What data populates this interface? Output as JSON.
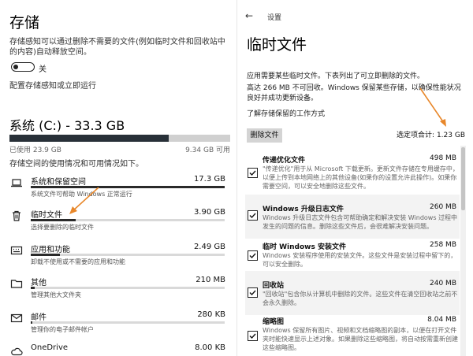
{
  "left": {
    "title": "存储",
    "sense_desc": "存储感知可以通过删除不需要的文件(例如临时文件和回收站中的内容)自动释放空间。",
    "toggle_label": "关",
    "config_link": "配置存储感知或立即运行",
    "drive_title": "系统 (C:) - 33.3 GB",
    "used": "已使用 23.9 GB",
    "available": "9.34 GB 可用",
    "drive_used_fraction": 0.72,
    "usage_desc": "存储空间的使用情况和可用情况如下。",
    "categories": [
      {
        "icon": "laptop-icon",
        "name": "系统和保留空间",
        "size": "17.3 GB",
        "sub": "系统文件可帮助 Windows 正常运行",
        "fraction": 1.0
      },
      {
        "icon": "trash-icon",
        "name": "临时文件",
        "size": "3.90 GB",
        "sub": "选择要删除的临时文件",
        "fraction": 0.23
      },
      {
        "icon": "keyboard-icon",
        "name": "应用和功能",
        "size": "2.49 GB",
        "sub": "卸载不使用或不需要的应用和功能",
        "fraction": 0.15
      },
      {
        "icon": "folder-icon",
        "name": "其他",
        "size": "210 MB",
        "sub": "管理其他大文件夹",
        "fraction": 0.02
      },
      {
        "icon": "mail-icon",
        "name": "邮件",
        "size": "280 KB",
        "sub": "管理你的电子邮件帐户",
        "fraction": 0.01
      },
      {
        "icon": "cloud-icon",
        "name": "OneDrive",
        "size": "8.00 KB",
        "sub": "",
        "fraction": 0.0
      }
    ]
  },
  "right": {
    "back_glyph": "←",
    "settings_label": "设置",
    "title": "临时文件",
    "desc1": "应用需要某些临时文件。下表列出了可立即删除的文件。",
    "desc2": "高达 266 MB 不可回收。Windows 保留某些存储，以确保性能状况良好并成功更新设备。",
    "link": "了解存储保留的工作方式",
    "delete_button": "删除文件",
    "total": "选定项合计: 1.23 GB",
    "files": [
      {
        "name": "传递优化文件",
        "size": "498 MB",
        "desc": "\"传递优化\"用于从 Microsoft 下载更新。更新文件存储在专用缓存中，以便上传到本地网络上的其他设备(如果你的设置允许此操作)。如果你需要空间，可以安全地删除这些文件。",
        "checked": true
      },
      {
        "name": "Windows 升级日志文件",
        "size": "260 MB",
        "desc": "Windows 升级日志文件包含可帮助确定和解决安装 Windows 过程中发生的问题的信息。删除这些文件后，会很难解决安装问题。",
        "checked": true
      },
      {
        "name": "临时 Windows 安装文件",
        "size": "258 MB",
        "desc": "Windows 安装程序使用的安装文件。这些文件是安装过程中留下的，可以安全删除。",
        "checked": true
      },
      {
        "name": "回收站",
        "size": "240 MB",
        "desc": "\"回收站\"包含你从计算机中删除的文件。这些文件在清空回收站之前不会永久删除。",
        "checked": true
      },
      {
        "name": "缩略图",
        "size": "8.04 MB",
        "desc": "Windows 保留所有图片、视频和文档缩略图的副本，以便在打开文件夹时能快速显示上述对象。如果删除这些缩略图，将自动按需重新创建这些缩略图。",
        "checked": true
      }
    ]
  }
}
